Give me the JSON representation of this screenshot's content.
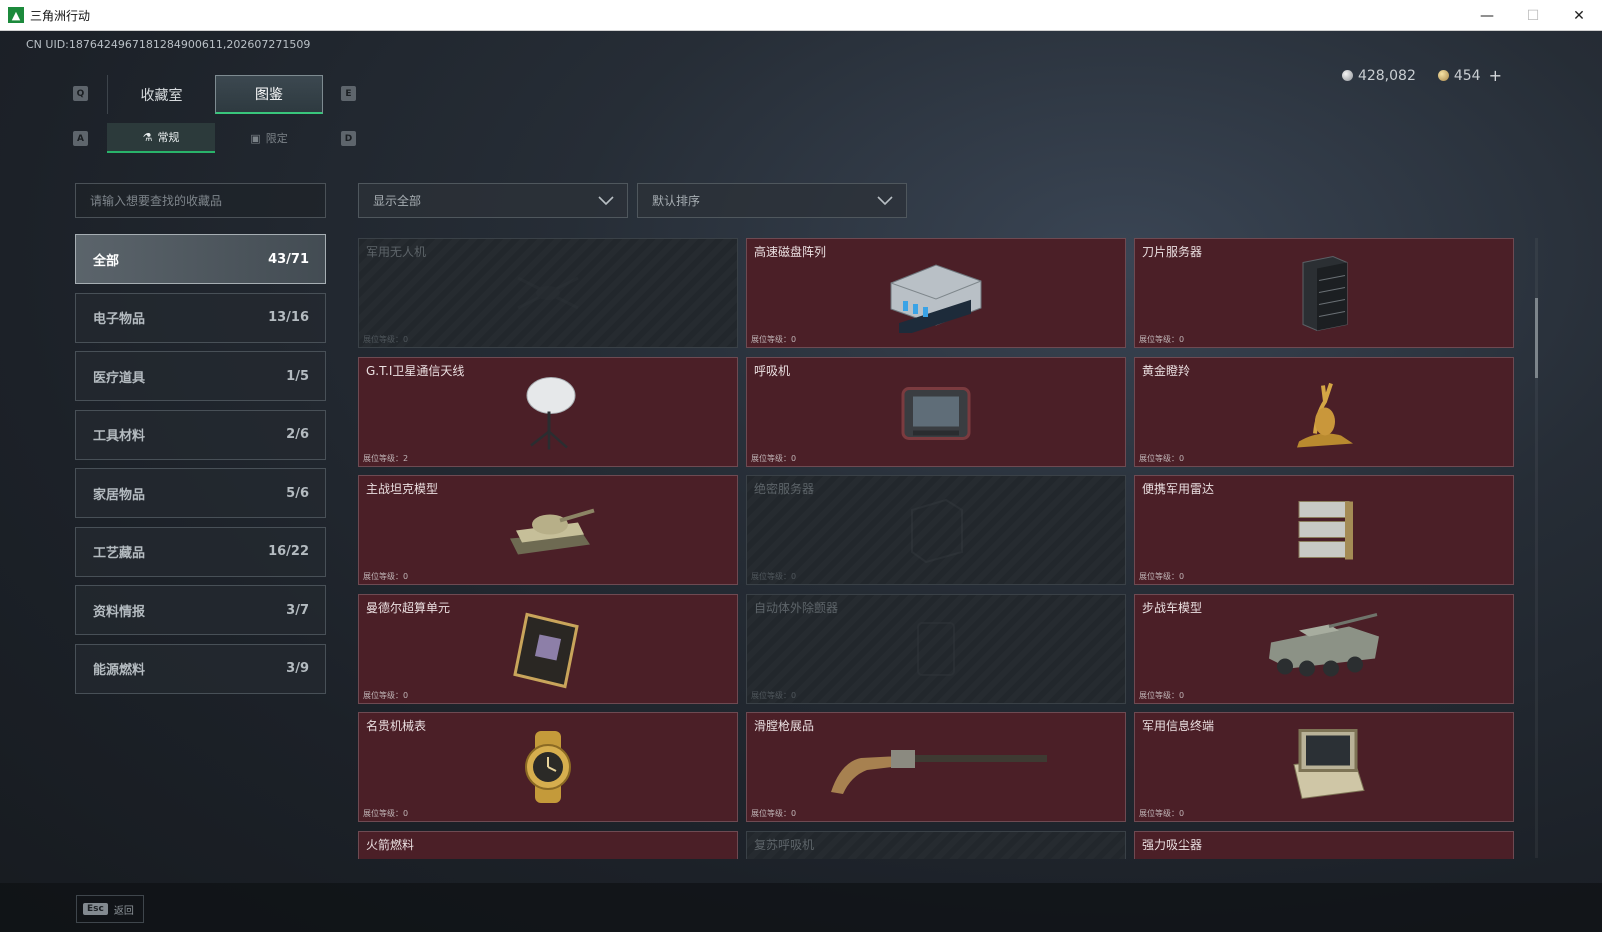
{
  "window": {
    "title": "三角洲行动",
    "icon_letter": "▲",
    "minimize": "—",
    "maximize": "☐",
    "close": "✕"
  },
  "uid": "CN UID:1876424967181284900611,202607271509",
  "currency": {
    "silver": "428,082",
    "gold": "454",
    "plus": "+"
  },
  "keys": {
    "q": "Q",
    "e": "E",
    "a": "A",
    "d": "D"
  },
  "tabs_main": [
    "收藏室",
    "图鉴"
  ],
  "tabs_sub": [
    "常规",
    "限定"
  ],
  "search": {
    "placeholder": "请输入想要查找的收藏品"
  },
  "dropdowns": {
    "filter": "显示全部",
    "sort": "默认排序"
  },
  "categories": [
    {
      "label": "全部",
      "count": "43/71"
    },
    {
      "label": "电子物品",
      "count": "13/16"
    },
    {
      "label": "医疗道具",
      "count": "1/5"
    },
    {
      "label": "工具材料",
      "count": "2/6"
    },
    {
      "label": "家居物品",
      "count": "5/6"
    },
    {
      "label": "工艺藏品",
      "count": "16/22"
    },
    {
      "label": "资料情报",
      "count": "3/7"
    },
    {
      "label": "能源燃料",
      "count": "3/9"
    }
  ],
  "items": [
    {
      "name": "军用无人机",
      "level": "展位等级：0",
      "locked": true,
      "icon": "drone-icon"
    },
    {
      "name": "高速磁盘阵列",
      "level": "展位等级：0",
      "locked": false,
      "icon": "disk-array-icon"
    },
    {
      "name": "刀片服务器",
      "level": "展位等级：0",
      "locked": false,
      "icon": "server-icon"
    },
    {
      "name": "G.T.I卫星通信天线",
      "level": "展位等级：2",
      "locked": false,
      "icon": "satellite-antenna-icon"
    },
    {
      "name": "呼吸机",
      "level": "展位等级：0",
      "locked": false,
      "icon": "ventilator-icon"
    },
    {
      "name": "黄金瞪羚",
      "level": "展位等级：0",
      "locked": false,
      "icon": "gold-gazelle-icon"
    },
    {
      "name": "主战坦克模型",
      "level": "展位等级：0",
      "locked": false,
      "icon": "tank-icon"
    },
    {
      "name": "绝密服务器",
      "level": "展位等级：0",
      "locked": true,
      "icon": "secret-server-icon"
    },
    {
      "name": "便携军用雷达",
      "level": "展位等级：0",
      "locked": false,
      "icon": "radar-icon"
    },
    {
      "name": "曼德尔超算单元",
      "level": "展位等级：0",
      "locked": false,
      "icon": "supercomputer-icon"
    },
    {
      "name": "自动体外除颤器",
      "level": "展位等级：0",
      "locked": true,
      "icon": "defibrillator-icon"
    },
    {
      "name": "步战车模型",
      "level": "展位等级：0",
      "locked": false,
      "icon": "ifv-icon"
    },
    {
      "name": "名贵机械表",
      "level": "展位等级：0",
      "locked": false,
      "icon": "watch-icon"
    },
    {
      "name": "滑膛枪展品",
      "level": "展位等级：0",
      "locked": false,
      "icon": "musket-icon"
    },
    {
      "name": "军用信息终端",
      "level": "展位等级：0",
      "locked": false,
      "icon": "terminal-icon"
    },
    {
      "name": "火箭燃料",
      "level": "",
      "locked": false,
      "icon": ""
    },
    {
      "name": "复苏呼吸机",
      "level": "",
      "locked": true,
      "icon": ""
    },
    {
      "name": "强力吸尘器",
      "level": "",
      "locked": false,
      "icon": ""
    }
  ],
  "footer": {
    "esc_key": "Esc",
    "back": "返回"
  },
  "colors": {
    "accent": "#39c67c",
    "card_bg": "#4b1f27",
    "locked_bg": "#22272c"
  }
}
